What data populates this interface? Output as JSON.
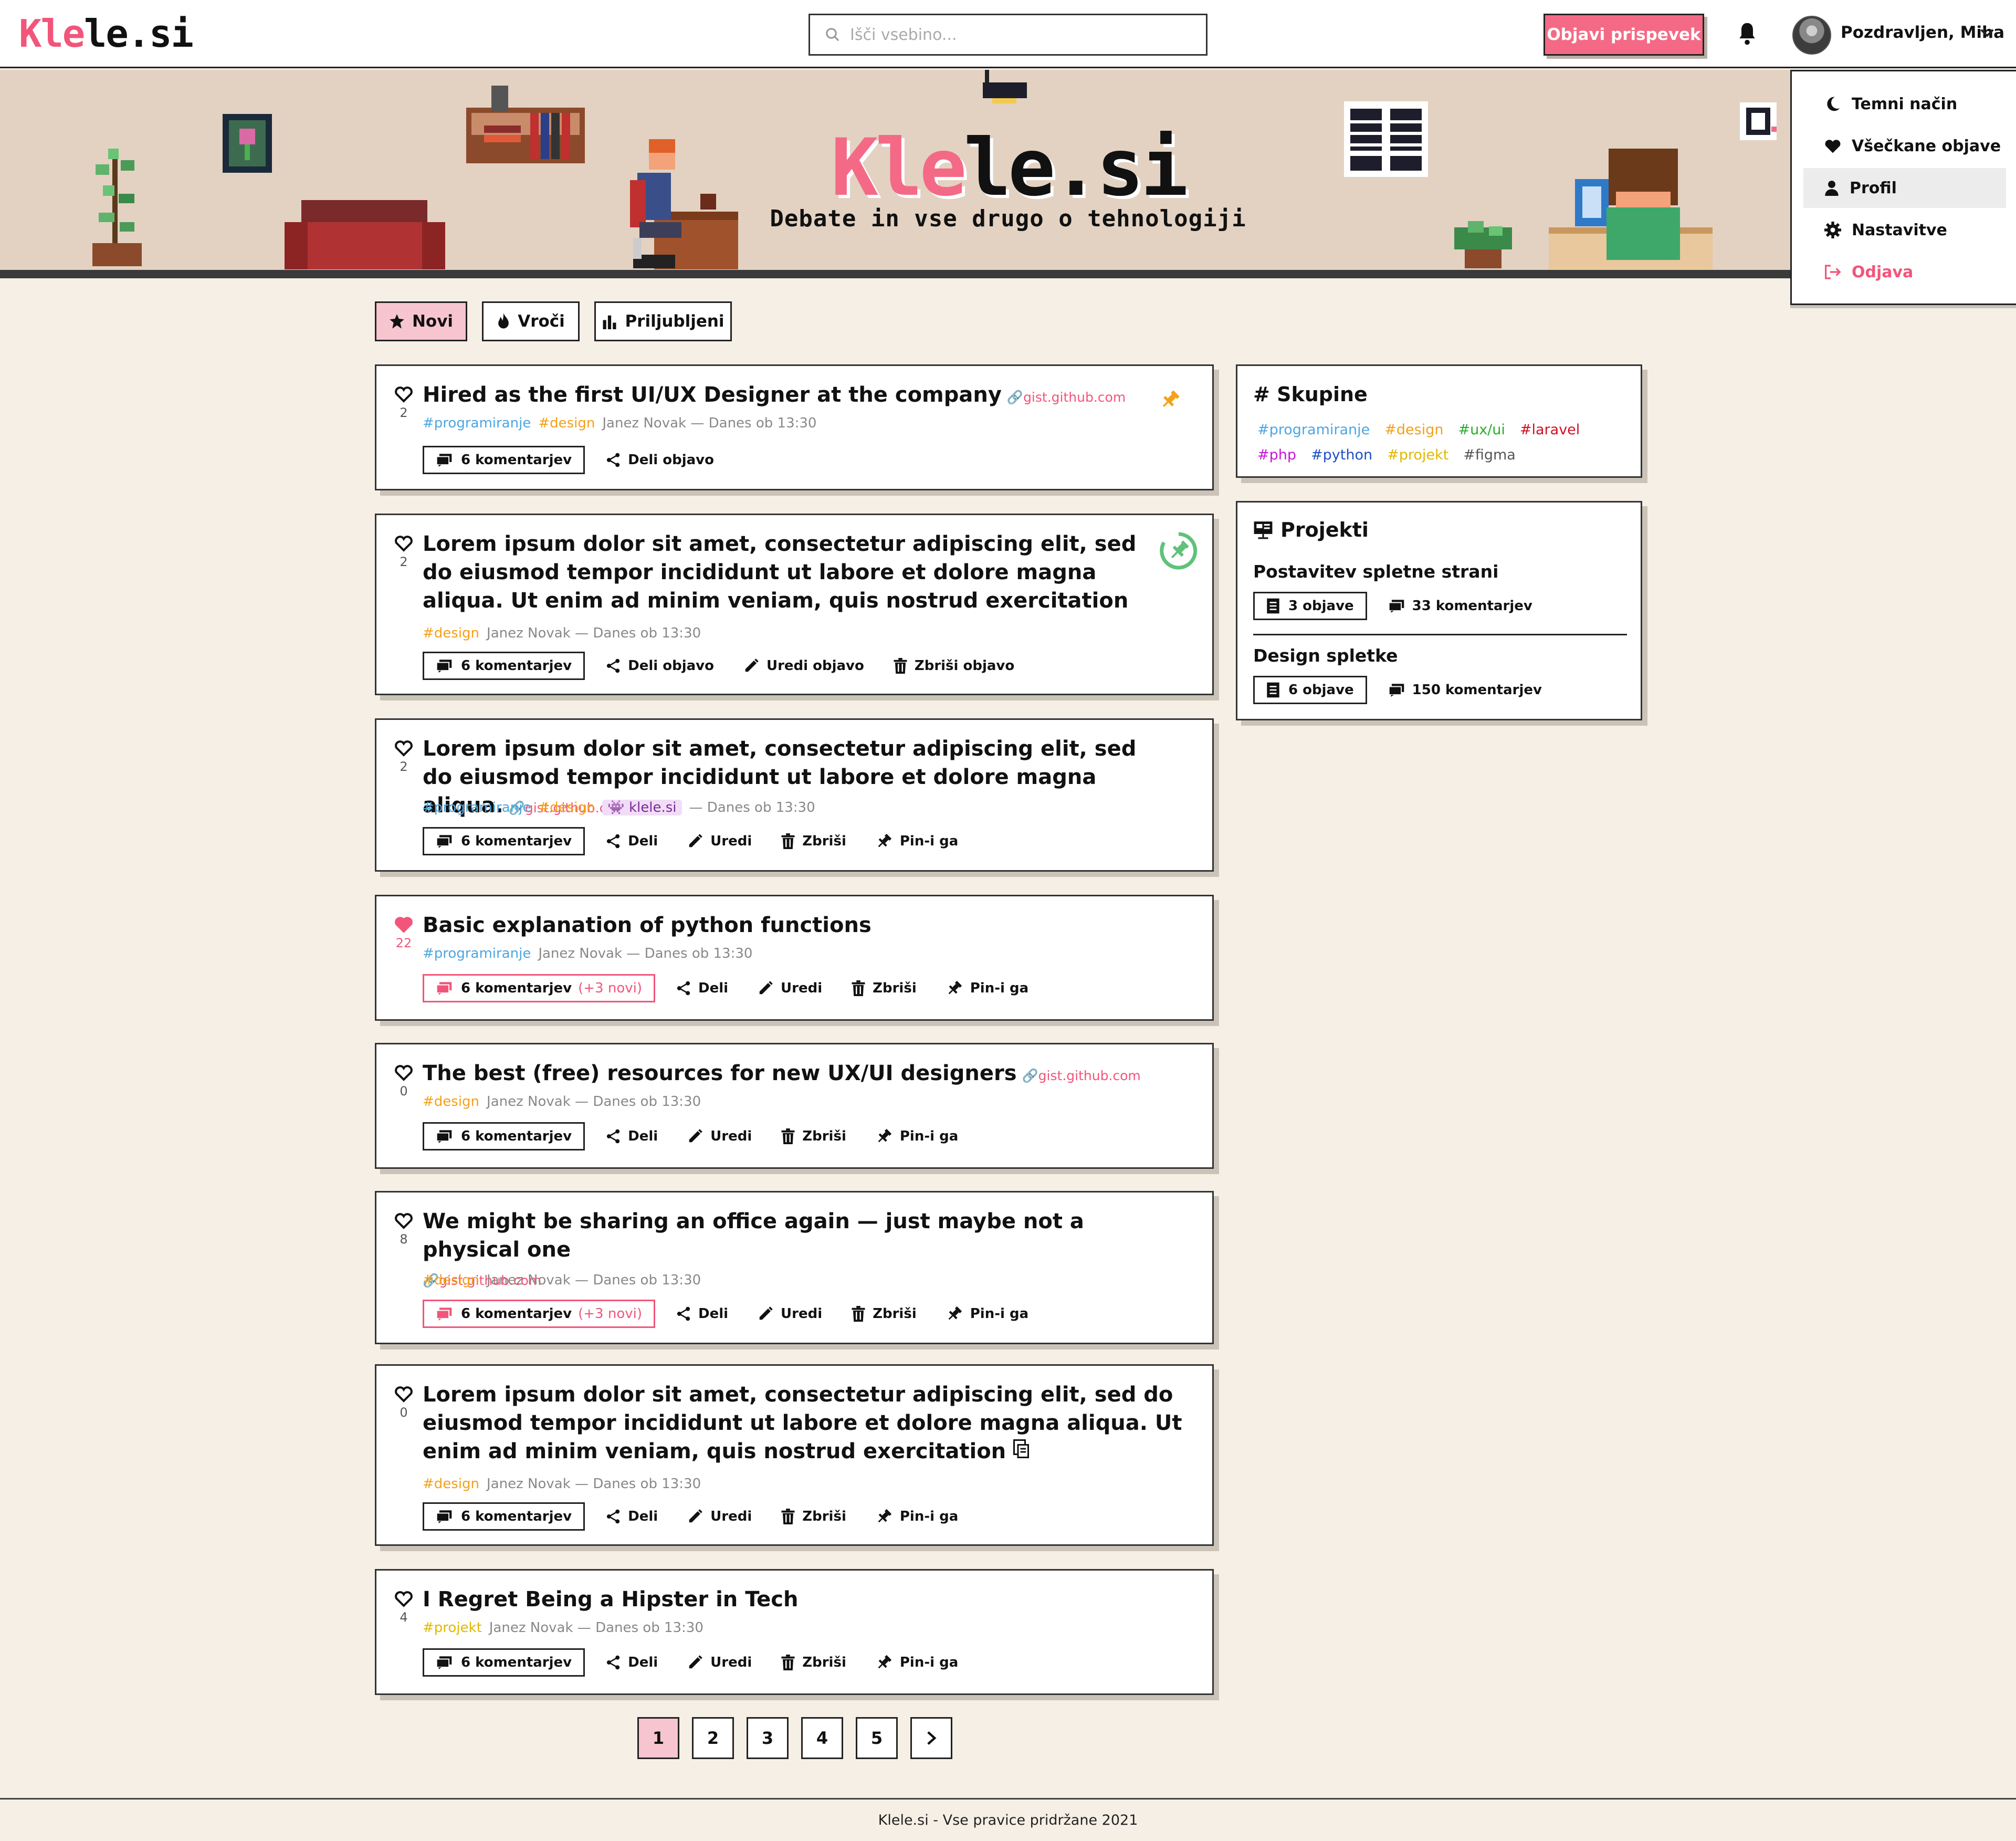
{
  "brand": {
    "logo_prefix": "Kle",
    "logo_suffix": "le.si",
    "accent": "#f46a86"
  },
  "header": {
    "search_placeholder": "Išči vsebino...",
    "new_post_label": "Objavi prispevek",
    "user_greeting": "Pozdravljen, Miha"
  },
  "banner": {
    "title_prefix": "Kle",
    "title_suffix": "le.si",
    "subtitle": "Debate in vse drugo o tehnologiji"
  },
  "user_menu": {
    "items": [
      {
        "label": "Temni način",
        "icon": "moon-icon"
      },
      {
        "label": "Všečkane objave",
        "icon": "heart-icon"
      },
      {
        "label": "Profil",
        "icon": "user-icon"
      },
      {
        "label": "Nastavitve",
        "icon": "gear-icon"
      },
      {
        "label": "Odjava",
        "icon": "logout-icon"
      }
    ]
  },
  "tabs": [
    {
      "label": "Novi",
      "icon": "star-icon",
      "active": true
    },
    {
      "label": "Vroči",
      "icon": "fire-icon",
      "active": false
    },
    {
      "label": "Priljubljeni",
      "icon": "bar-chart-icon",
      "active": false
    }
  ],
  "posts": [
    {
      "likes": "2",
      "liked": false,
      "title": "Hired as the first UI/UX Designer at the company",
      "link": "gist.github.com",
      "tags": [
        "#programiranje",
        "#design"
      ],
      "author": "Janez Novak",
      "date": "Danes ob 13:30",
      "comments": "6 komentarjev",
      "actions": [
        "Deli objavo"
      ]
    },
    {
      "likes": "2",
      "liked": false,
      "title": "Lorem ipsum dolor sit amet, consectetur adipiscing elit, sed do eiusmod tempor incididunt ut labore et dolore magna aliqua. Ut enim ad minim veniam, quis nostrud exercitation",
      "tags": [
        "#design"
      ],
      "author": "Janez Novak",
      "date": "Danes ob 13:30",
      "comments": "6 komentarjev",
      "actions": [
        "Deli objavo",
        "Uredi objavo",
        "Zbriši objavo"
      ]
    },
    {
      "likes": "2",
      "liked": false,
      "title": "Lorem ipsum dolor sit amet, consectetur adipiscing elit, sed do eiusmod tempor incididunt ut labore et dolore magna aliqua.",
      "link": "gist.github.com",
      "tags": [
        "#programiranje",
        "#design"
      ],
      "group": "klele.si",
      "author": "",
      "date": "Danes ob 13:30",
      "comments": "6 komentarjev",
      "actions": [
        "Deli",
        "Uredi",
        "Zbriši",
        "Pin-i ga"
      ]
    },
    {
      "likes": "22",
      "liked": true,
      "title": "Basic explanation of python functions",
      "tags": [
        "#programiranje"
      ],
      "author": "Janez Novak",
      "date": "Danes ob 13:30",
      "comments": "6 komentarjev",
      "new_comments": "(+3 novi)",
      "actions": [
        "Deli",
        "Uredi",
        "Zbriši",
        "Pin-i ga"
      ]
    },
    {
      "likes": "0",
      "liked": false,
      "title": "The best (free) resources for new UX/UI designers",
      "link": "gist.github.com",
      "tags": [
        "#design"
      ],
      "author": "Janez Novak",
      "date": "Danes ob 13:30",
      "comments": "6 komentarjev",
      "actions": [
        "Deli",
        "Uredi",
        "Zbriši",
        "Pin-i ga"
      ]
    },
    {
      "likes": "8",
      "liked": false,
      "title": "We might be sharing an office again — just maybe not a physical one",
      "link": "gist.github.com",
      "tags": [
        "#design"
      ],
      "author": "Janez Novak",
      "date": "Danes ob 13:30",
      "comments": "6 komentarjev",
      "new_comments": "(+3 novi)",
      "actions": [
        "Deli",
        "Uredi",
        "Zbriši",
        "Pin-i ga"
      ]
    },
    {
      "likes": "0",
      "liked": false,
      "title": "Lorem ipsum dolor sit amet, consectetur adipiscing elit, sed do eiusmod tempor incididunt ut labore et dolore magna aliqua. Ut enim ad minim veniam, quis nostrud exercitation",
      "tags": [
        "#design"
      ],
      "author": "Janez Novak",
      "date": "Danes ob 13:30",
      "comments": "6 komentarjev",
      "actions": [
        "Deli",
        "Uredi",
        "Zbriši",
        "Pin-i ga"
      ]
    },
    {
      "likes": "4",
      "liked": false,
      "title": "I Regret Being a Hipster in Tech",
      "tags": [
        "#projekt"
      ],
      "author": "Janez Novak",
      "date": "Danes ob 13:30",
      "comments": "6 komentarjev",
      "actions": [
        "Deli",
        "Uredi",
        "Zbriši",
        "Pin-i ga"
      ]
    }
  ],
  "sidebar": {
    "groups_title": "Skupine",
    "groups": [
      "#programiranje",
      "#design",
      "#ux/ui",
      "#laravel",
      "#php",
      "#python",
      "#projekt",
      "#figma"
    ],
    "projects_title": "Projekti",
    "projects": [
      {
        "name": "Postavitev spletne strani",
        "posts": "3 objave",
        "comments": "33 komentarjev"
      },
      {
        "name": "Design spletke",
        "posts": "6 objave",
        "comments": "150 komentarjev"
      }
    ]
  },
  "pagination": [
    "1",
    "2",
    "3",
    "4",
    "5"
  ],
  "footer": "Klele.si - Vse pravice pridržane 2021"
}
